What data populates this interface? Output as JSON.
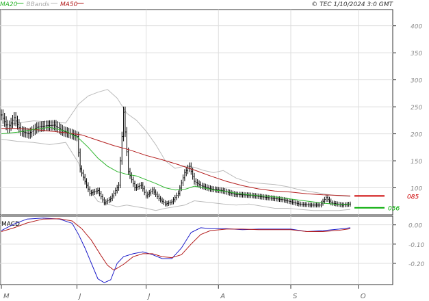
{
  "header": {
    "legend": [
      {
        "label": "MA20",
        "color": "#2db52d"
      },
      {
        "label": "BBands",
        "color": "#bbbbbb"
      },
      {
        "label": "MA50",
        "color": "#b31c1c"
      }
    ],
    "copyright": "© TEC 1/10/2024 3:0 GMT"
  },
  "chart_data": [
    {
      "type": "candlestick",
      "panel": "price",
      "y_ticks": [
        "400",
        "350",
        "300",
        "250",
        "200",
        "150",
        "100"
      ],
      "ylim": [
        50,
        430
      ],
      "x_ticks": [
        "M",
        "J",
        "J",
        "A",
        "S",
        "O"
      ],
      "x_tick_index": [
        0,
        47,
        90,
        135,
        180,
        222
      ],
      "grid": true,
      "last_values": {
        "ma50_label": "085",
        "ma50": 85,
        "ma20_label": "056",
        "ma20": 63
      },
      "price_points": [
        [
          0,
          235
        ],
        [
          4,
          210
        ],
        [
          8,
          230
        ],
        [
          12,
          205
        ],
        [
          17,
          200
        ],
        [
          22,
          212
        ],
        [
          28,
          215
        ],
        [
          33,
          216
        ],
        [
          38,
          205
        ],
        [
          43,
          200
        ],
        [
          47,
          195
        ],
        [
          49,
          135
        ],
        [
          52,
          112
        ],
        [
          55,
          90
        ],
        [
          60,
          95
        ],
        [
          64,
          72
        ],
        [
          68,
          80
        ],
        [
          73,
          105
        ],
        [
          76,
          240
        ],
        [
          79,
          130
        ],
        [
          83,
          100
        ],
        [
          87,
          105
        ],
        [
          90,
          85
        ],
        [
          94,
          96
        ],
        [
          98,
          80
        ],
        [
          102,
          70
        ],
        [
          106,
          74
        ],
        [
          110,
          90
        ],
        [
          114,
          128
        ],
        [
          117,
          140
        ],
        [
          120,
          112
        ],
        [
          124,
          104
        ],
        [
          130,
          98
        ],
        [
          137,
          95
        ],
        [
          145,
          88
        ],
        [
          155,
          86
        ],
        [
          165,
          82
        ],
        [
          175,
          78
        ],
        [
          185,
          70
        ],
        [
          192,
          68
        ],
        [
          198,
          68
        ],
        [
          202,
          82
        ],
        [
          205,
          72
        ],
        [
          212,
          68
        ],
        [
          217,
          70
        ]
      ],
      "ma20": [
        [
          0,
          200
        ],
        [
          10,
          203
        ],
        [
          20,
          208
        ],
        [
          30,
          212
        ],
        [
          40,
          205
        ],
        [
          48,
          192
        ],
        [
          54,
          175
        ],
        [
          60,
          155
        ],
        [
          66,
          140
        ],
        [
          72,
          130
        ],
        [
          78,
          125
        ],
        [
          84,
          122
        ],
        [
          90,
          115
        ],
        [
          96,
          108
        ],
        [
          102,
          100
        ],
        [
          108,
          96
        ],
        [
          114,
          97
        ],
        [
          120,
          103
        ],
        [
          126,
          100
        ],
        [
          132,
          96
        ],
        [
          138,
          94
        ],
        [
          146,
          90
        ],
        [
          154,
          87
        ],
        [
          162,
          85
        ],
        [
          170,
          83
        ],
        [
          178,
          80
        ],
        [
          186,
          77
        ],
        [
          194,
          74
        ],
        [
          202,
          71
        ],
        [
          210,
          69
        ],
        [
          217,
          70
        ]
      ],
      "ma50": [
        [
          0,
          210
        ],
        [
          10,
          210
        ],
        [
          20,
          208
        ],
        [
          30,
          205
        ],
        [
          40,
          202
        ],
        [
          50,
          198
        ],
        [
          60,
          188
        ],
        [
          70,
          178
        ],
        [
          80,
          170
        ],
        [
          90,
          160
        ],
        [
          100,
          152
        ],
        [
          110,
          143
        ],
        [
          120,
          133
        ],
        [
          130,
          122
        ],
        [
          140,
          112
        ],
        [
          150,
          104
        ],
        [
          160,
          98
        ],
        [
          170,
          94
        ],
        [
          180,
          92
        ],
        [
          190,
          89
        ],
        [
          200,
          87
        ],
        [
          210,
          86
        ],
        [
          217,
          85
        ]
      ],
      "bb_upper": [
        [
          0,
          215
        ],
        [
          10,
          220
        ],
        [
          20,
          224
        ],
        [
          30,
          222
        ],
        [
          40,
          220
        ],
        [
          48,
          255
        ],
        [
          54,
          270
        ],
        [
          60,
          277
        ],
        [
          66,
          282
        ],
        [
          72,
          266
        ],
        [
          78,
          238
        ],
        [
          84,
          225
        ],
        [
          90,
          205
        ],
        [
          96,
          180
        ],
        [
          102,
          150
        ],
        [
          108,
          136
        ],
        [
          114,
          140
        ],
        [
          120,
          138
        ],
        [
          126,
          132
        ],
        [
          132,
          128
        ],
        [
          138,
          132
        ],
        [
          146,
          118
        ],
        [
          154,
          110
        ],
        [
          162,
          108
        ],
        [
          170,
          106
        ],
        [
          178,
          102
        ],
        [
          186,
          96
        ],
        [
          194,
          92
        ],
        [
          202,
          88
        ],
        [
          210,
          85
        ],
        [
          217,
          84
        ]
      ],
      "bb_lower": [
        [
          0,
          190
        ],
        [
          10,
          186
        ],
        [
          20,
          184
        ],
        [
          30,
          180
        ],
        [
          40,
          184
        ],
        [
          48,
          146
        ],
        [
          54,
          100
        ],
        [
          60,
          75
        ],
        [
          66,
          70
        ],
        [
          72,
          65
        ],
        [
          78,
          68
        ],
        [
          84,
          65
        ],
        [
          90,
          62
        ],
        [
          96,
          58
        ],
        [
          102,
          62
        ],
        [
          108,
          65
        ],
        [
          114,
          68
        ],
        [
          120,
          76
        ],
        [
          126,
          74
        ],
        [
          132,
          72
        ],
        [
          138,
          70
        ],
        [
          146,
          68
        ],
        [
          154,
          70
        ],
        [
          162,
          66
        ],
        [
          170,
          62
        ],
        [
          178,
          62
        ],
        [
          186,
          60
        ],
        [
          194,
          58
        ],
        [
          202,
          58
        ],
        [
          210,
          58
        ],
        [
          217,
          60
        ]
      ]
    },
    {
      "type": "line",
      "panel": "macd",
      "title": "MACD",
      "y_ticks": [
        "0.00",
        "-0.10",
        "-0.20"
      ],
      "ylim": [
        -0.31,
        0.045
      ],
      "series": [
        {
          "color": "#1c1cc9",
          "values": [
            [
              0,
              -0.03
            ],
            [
              8,
              0.005
            ],
            [
              16,
              0.03
            ],
            [
              26,
              0.035
            ],
            [
              36,
              0.03
            ],
            [
              44,
              0.008
            ],
            [
              48,
              -0.05
            ],
            [
              52,
              -0.12
            ],
            [
              56,
              -0.2
            ],
            [
              60,
              -0.28
            ],
            [
              64,
              -0.3
            ],
            [
              68,
              -0.285
            ],
            [
              72,
              -0.2
            ],
            [
              76,
              -0.165
            ],
            [
              82,
              -0.15
            ],
            [
              88,
              -0.14
            ],
            [
              94,
              -0.155
            ],
            [
              100,
              -0.175
            ],
            [
              106,
              -0.175
            ],
            [
              112,
              -0.12
            ],
            [
              118,
              -0.04
            ],
            [
              124,
              -0.015
            ],
            [
              130,
              -0.02
            ],
            [
              140,
              -0.02
            ],
            [
              150,
              -0.025
            ],
            [
              160,
              -0.022
            ],
            [
              170,
              -0.022
            ],
            [
              180,
              -0.022
            ],
            [
              190,
              -0.035
            ],
            [
              200,
              -0.03
            ],
            [
              210,
              -0.022
            ],
            [
              217,
              -0.015
            ]
          ]
        },
        {
          "color": "#b31c1c",
          "values": [
            [
              0,
              -0.035
            ],
            [
              8,
              -0.015
            ],
            [
              16,
              0.01
            ],
            [
              26,
              0.03
            ],
            [
              36,
              0.032
            ],
            [
              44,
              0.02
            ],
            [
              50,
              -0.02
            ],
            [
              56,
              -0.08
            ],
            [
              62,
              -0.16
            ],
            [
              66,
              -0.21
            ],
            [
              70,
              -0.235
            ],
            [
              76,
              -0.205
            ],
            [
              82,
              -0.165
            ],
            [
              88,
              -0.15
            ],
            [
              94,
              -0.15
            ],
            [
              100,
              -0.165
            ],
            [
              106,
              -0.17
            ],
            [
              112,
              -0.155
            ],
            [
              118,
              -0.1
            ],
            [
              124,
              -0.05
            ],
            [
              130,
              -0.03
            ],
            [
              140,
              -0.022
            ],
            [
              150,
              -0.022
            ],
            [
              160,
              -0.025
            ],
            [
              170,
              -0.025
            ],
            [
              180,
              -0.025
            ],
            [
              190,
              -0.035
            ],
            [
              200,
              -0.035
            ],
            [
              210,
              -0.028
            ],
            [
              217,
              -0.02
            ]
          ]
        }
      ]
    }
  ]
}
